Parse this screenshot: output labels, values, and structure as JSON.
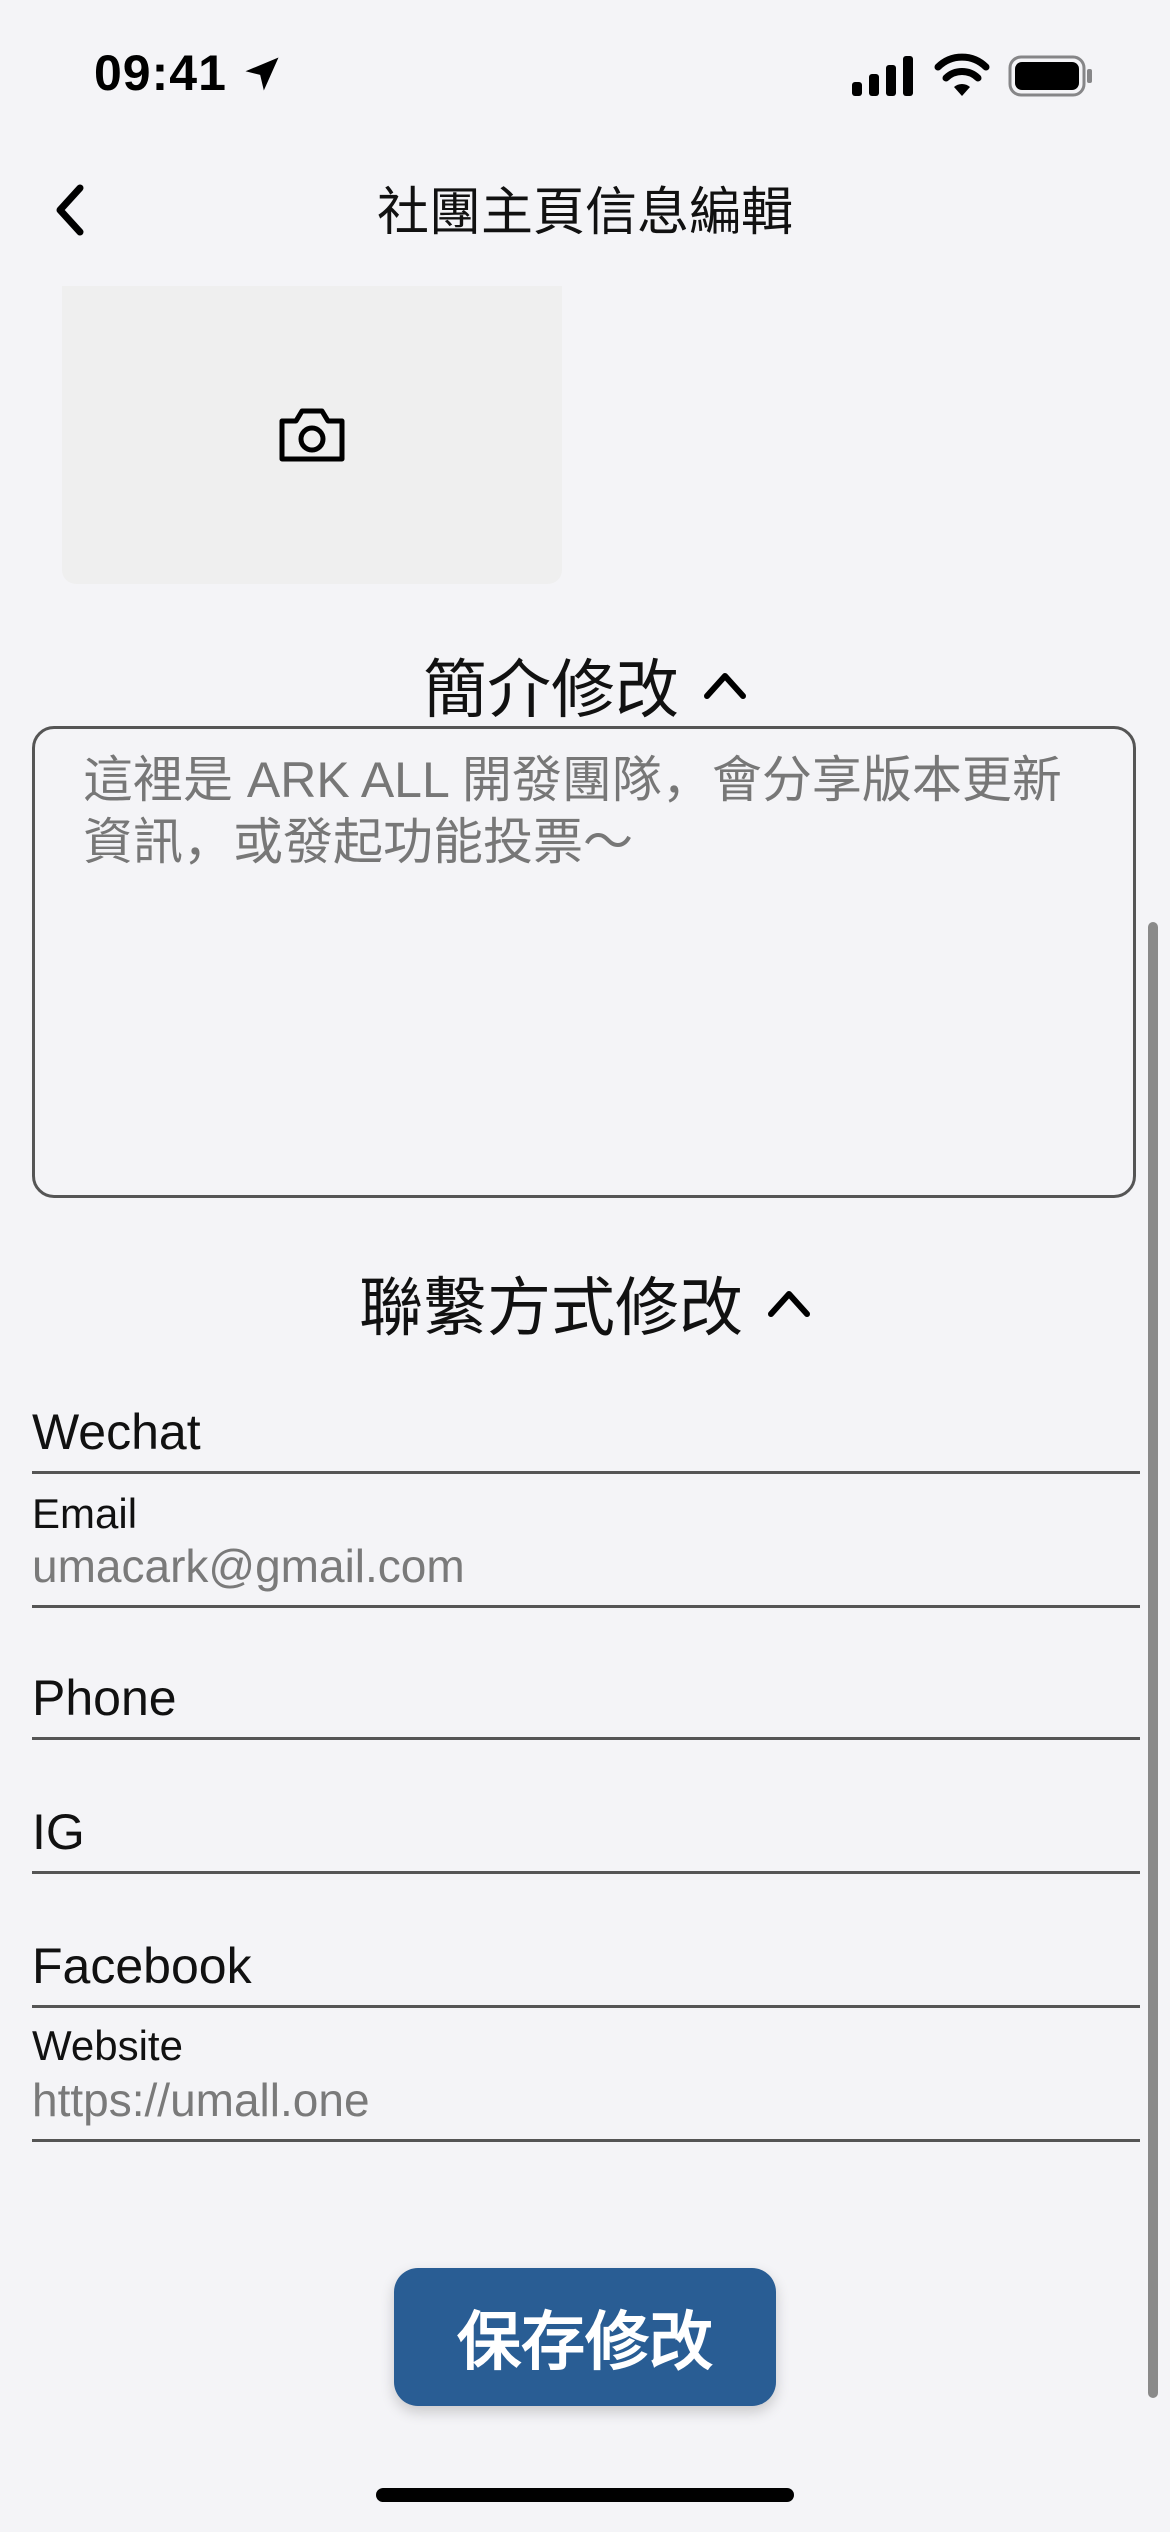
{
  "status_bar": {
    "time": "09:41",
    "icons": [
      "location-arrow-icon",
      "cellular-signal-icon",
      "wifi-icon",
      "battery-icon"
    ]
  },
  "nav": {
    "title": "社團主頁信息編輯",
    "back_icon": "chevron-left-icon"
  },
  "photo": {
    "icon": "camera-icon"
  },
  "intro": {
    "header": "簡介修改",
    "text": "這裡是 ARK ALL 開發團隊，會分享版本更新資訊，或發起功能投票～"
  },
  "contact": {
    "header": "聯繫方式修改",
    "fields": [
      {
        "label": "Wechat",
        "value": ""
      },
      {
        "label": "Email",
        "value": "umacark@gmail.com"
      },
      {
        "label": "Phone",
        "value": ""
      },
      {
        "label": "IG",
        "value": ""
      },
      {
        "label": "Facebook",
        "value": ""
      },
      {
        "label": "Website",
        "value": "https://umall.one"
      }
    ]
  },
  "actions": {
    "save_label": "保存修改"
  },
  "colors": {
    "background": "#f4f4f7",
    "accent": "#295d94",
    "placeholder": "#7a7a7a"
  }
}
